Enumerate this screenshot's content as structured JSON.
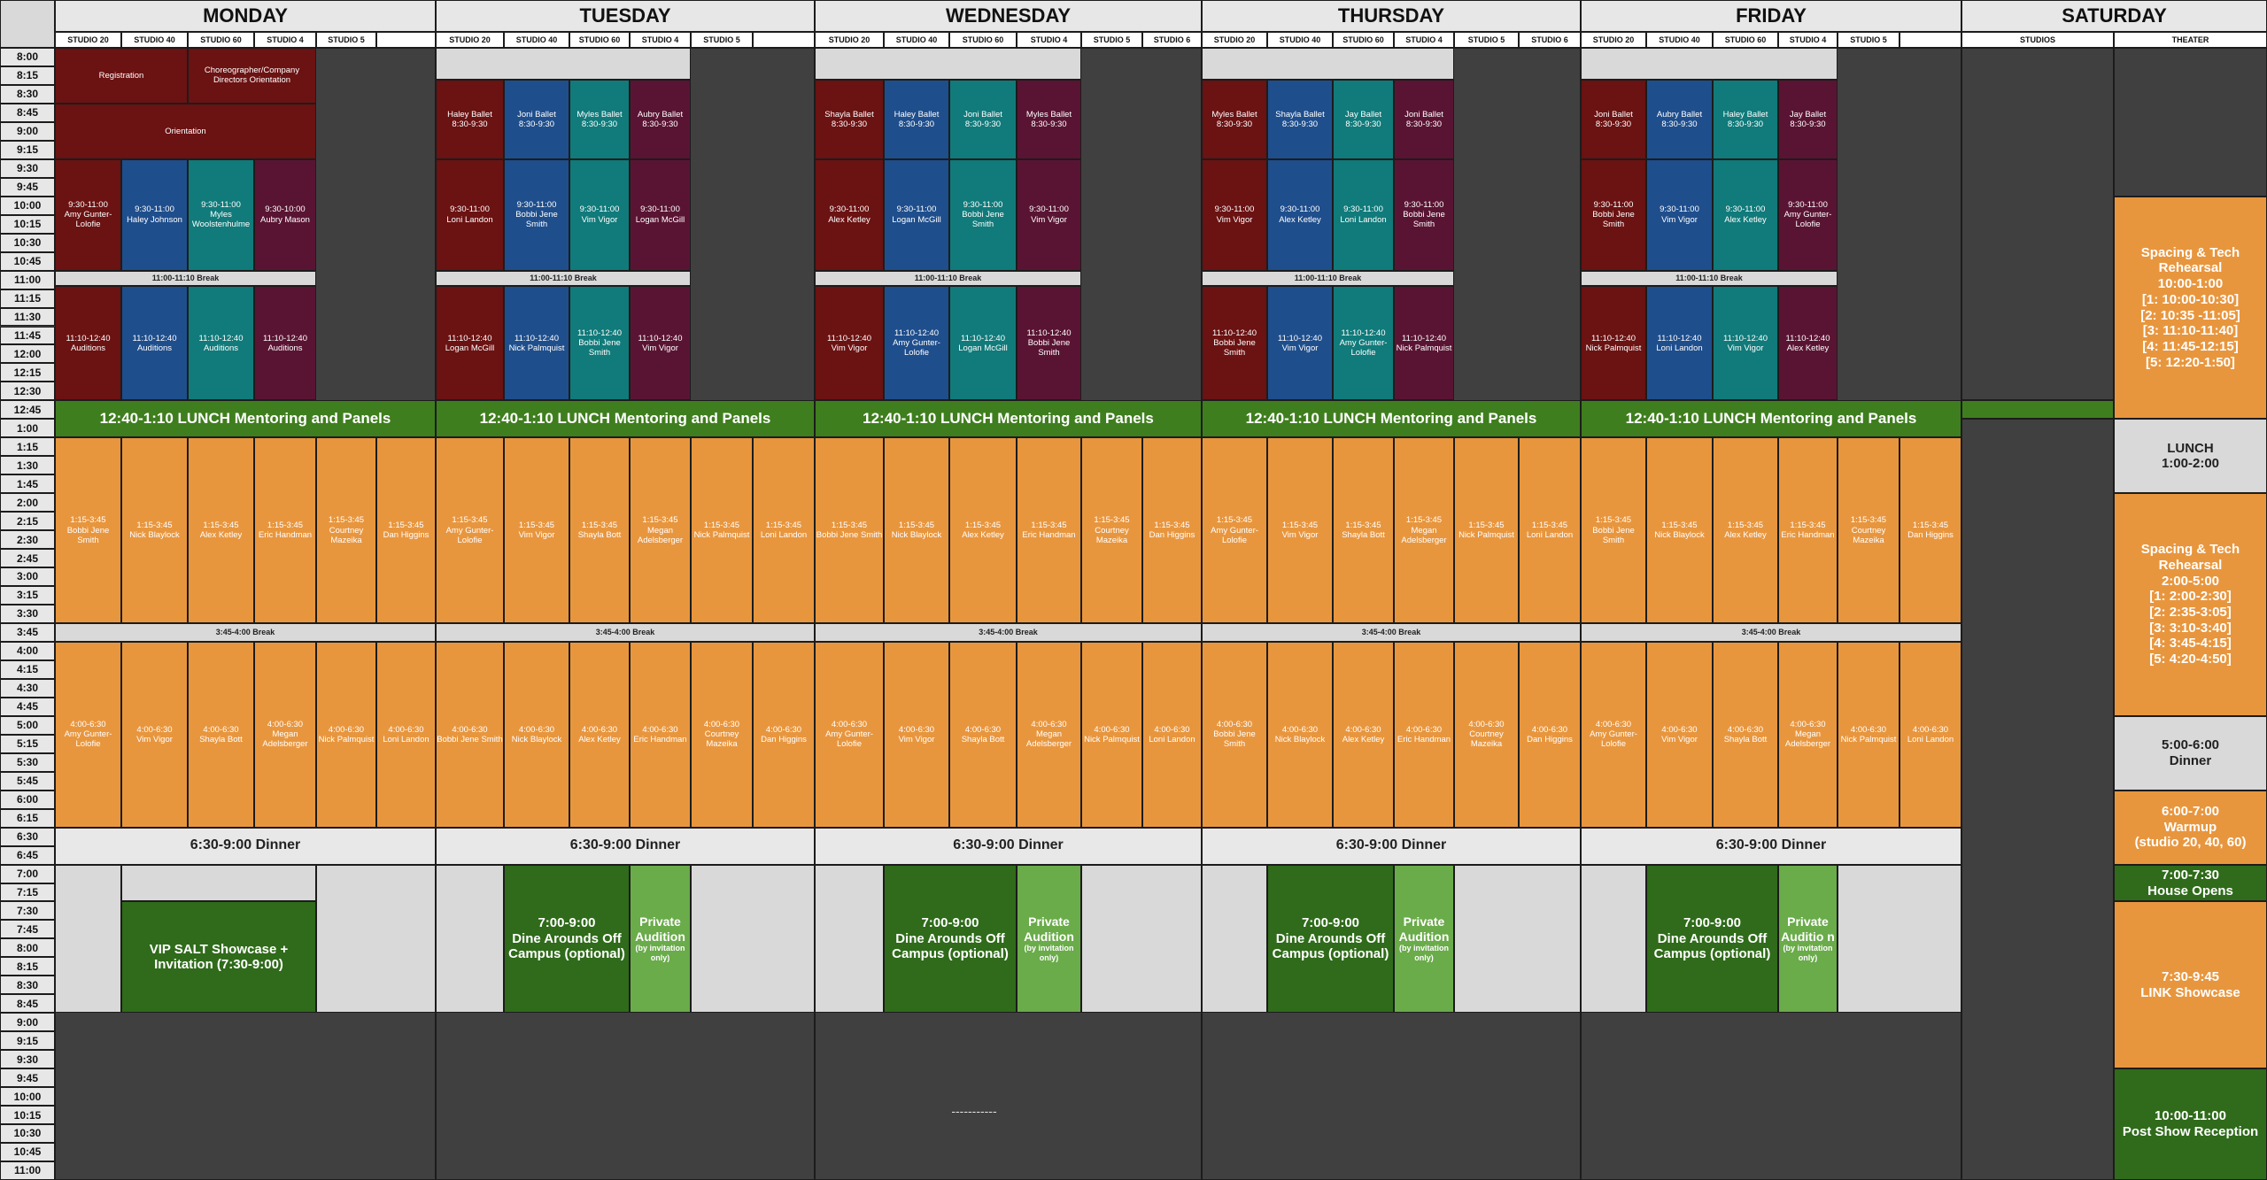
{
  "days": [
    "MONDAY",
    "TUESDAY",
    "WEDNESDAY",
    "THURSDAY",
    "FRIDAY",
    "SATURDAY"
  ],
  "studio_headers": {
    "mon": [
      "STUDIO 20",
      "STUDIO 40",
      "STUDIO 60",
      "STUDIO 4",
      "STUDIO 5"
    ],
    "tue": [
      "STUDIO 20",
      "STUDIO 40",
      "STUDIO 60",
      "STUDIO 4",
      "STUDIO 5"
    ],
    "wed": [
      "STUDIO 20",
      "STUDIO 40",
      "STUDIO 60",
      "STUDIO 4",
      "STUDIO 5",
      "STUDIO 6"
    ],
    "thu": [
      "STUDIO 20",
      "STUDIO 40",
      "STUDIO 60",
      "STUDIO 4",
      "STUDIO 5",
      "STUDIO 6"
    ],
    "fri": [
      "STUDIO 20",
      "STUDIO 40",
      "STUDIO 60",
      "STUDIO 4",
      "STUDIO 5"
    ],
    "sat": [
      "STUDIOS",
      "THEATER"
    ]
  },
  "times": [
    "8:00",
    "8:15",
    "8:30",
    "8:45",
    "9:00",
    "9:15",
    "9:30",
    "9:45",
    "10:00",
    "10:15",
    "10:30",
    "10:45",
    "11:00",
    "11:15",
    "11:30",
    "11:45",
    "12:00",
    "12:15",
    "12:30",
    "12:45",
    "1:00",
    "1:15",
    "1:30",
    "1:45",
    "2:00",
    "2:15",
    "2:30",
    "2:45",
    "3:00",
    "3:15",
    "3:30",
    "3:45",
    "4:00",
    "4:15",
    "4:30",
    "4:45",
    "5:00",
    "5:15",
    "5:30",
    "5:45",
    "6:00",
    "6:15",
    "6:30",
    "6:45",
    "7:00",
    "7:15",
    "7:30",
    "7:45",
    "8:00",
    "8:15",
    "8:30",
    "8:45",
    "9:00",
    "9:15",
    "9:30",
    "9:45",
    "10:00",
    "10:15",
    "10:30",
    "10:45",
    "11:00"
  ],
  "colors": {
    "maroon": "#6b1212",
    "blue": "#1f4e8c",
    "teal": "#117a7a",
    "plum": "#5a1433",
    "orange": "#e8963e",
    "green": "#3f7e1e",
    "dark_green": "#2f6b1a",
    "light_green": "#6aab4a",
    "gray": "#d9d9d9",
    "dark": "#404040"
  },
  "monday": {
    "registration": "Registration",
    "orientation_directors": "Choreographer/Company Directors Orientation",
    "orientation": "Orientation",
    "morning": [
      "9:30-11:00\nAmy Gunter-Lolofie",
      "9:30-11:00\nHaley Johnson",
      "9:30-11:00\nMyles Woolstenhulme",
      "9:30-10:00\nAubry Mason"
    ],
    "break_am": "11:00-11:10 Break",
    "auditions": [
      "11:10-12:40\nAuditions",
      "11:10-12:40\nAuditions",
      "11:10-12:40\nAuditions",
      "11:10-12:40\nAuditions"
    ],
    "lunch": "12:40-1:10 LUNCH Mentoring and Panels",
    "pm1": [
      "1:15-3:45\nBobbi Jene Smith",
      "1:15-3:45\nNick Blaylock",
      "1:15-3:45\nAlex Ketley",
      "1:15-3:45\nEric Handman",
      "1:15-3:45\nCourtney Mazeika",
      "1:15-3:45\nDan Higgins"
    ],
    "break_pm": "3:45-4:00 Break",
    "pm2": [
      "4:00-6:30\nAmy Gunter-Lolofie",
      "4:00-6:30\nVim Vigor",
      "4:00-6:30\nShayla Bott",
      "4:00-6:30\nMegan Adelsberger",
      "4:00-6:30\nNick Palmquist",
      "4:00-6:30\nLoni Landon"
    ],
    "dinner": "6:30-9:00 Dinner",
    "evening": "VIP SALT Showcase + Invitation (7:30-9:00)"
  },
  "tuesday": {
    "ballet": [
      "Haley Ballet\n8:30-9:30",
      "Joni Ballet\n8:30-9:30",
      "Myles Ballet\n8:30-9:30",
      "Aubry Ballet 8:30-9:30"
    ],
    "morning": [
      "9:30-11:00\nLoni Landon",
      "9:30-11:00\nBobbi Jene Smith",
      "9:30-11:00\nVim Vigor",
      "9:30-11:00\nLogan McGill"
    ],
    "break_am": "11:00-11:10 Break",
    "late": [
      "11:10-12:40\nLogan McGill",
      "11:10-12:40\nNick Palmquist",
      "11:10-12:40\nBobbi Jene Smith",
      "11:10-12:40\nVim Vigor"
    ],
    "lunch": "12:40-1:10 LUNCH Mentoring and Panels",
    "pm1": [
      "1:15-3:45\nAmy Gunter-Lolofie",
      "1:15-3:45\nVim Vigor",
      "1:15-3:45\nShayla Bott",
      "1:15-3:45\nMegan Adelsberger",
      "1:15-3:45\nNick Palmquist",
      "1:15-3:45\nLoni Landon"
    ],
    "break_pm": "3:45-4:00 Break",
    "pm2": [
      "4:00-6:30\nBobbi Jene Smith",
      "4:00-6:30\nNick Blaylock",
      "4:00-6:30\nAlex Ketley",
      "4:00-6:30\nEric Handman",
      "4:00-6:30\nCourtney Mazeika",
      "4:00-6:30\nDan Higgins"
    ],
    "dinner": "6:30-9:00 Dinner",
    "dine": "7:00-9:00\nDine Arounds Off Campus (optional)",
    "private": "Private Audition",
    "private_note": "(by invitation only)"
  },
  "wednesday": {
    "ballet": [
      "Shayla Ballet\n8:30-9:30",
      "Haley Ballet\n8:30-9:30",
      "Joni Ballet\n8:30-9:30",
      "Myles Ballet 8:30-9:30"
    ],
    "morning": [
      "9:30-11:00\nAlex Ketley",
      "9:30-11:00\nLogan McGill",
      "9:30-11:00\nBobbi Jene Smith",
      "9:30-11:00\nVim Vigor"
    ],
    "break_am": "11:00-11:10 Break",
    "late": [
      "11:10-12:40\nVim Vigor",
      "11:10-12:40\nAmy Gunter-Lolofie",
      "11:10-12:40\nLogan McGill",
      "11:10-12:40\nBobbi Jene Smith"
    ],
    "lunch": "12:40-1:10 LUNCH Mentoring and Panels",
    "pm1": [
      "1:15-3:45\nBobbi Jene Smith",
      "1:15-3:45\nNick Blaylock",
      "1:15-3:45\nAlex Ketley",
      "1:15-3:45\nEric Handman",
      "1:15-3:45\nCourtney Mazeika",
      "1:15-3:45\nDan Higgins"
    ],
    "break_pm": "3:45-4:00 Break",
    "pm2": [
      "4:00-6:30\nAmy Gunter-Lolofie",
      "4:00-6:30\nVim Vigor",
      "4:00-6:30\nShayla Bott",
      "4:00-6:30\nMegan Adelsberger",
      "4:00-6:30\nNick Palmquist",
      "4:00-6:30\nLoni Landon"
    ],
    "dinner": "6:30-9:00 Dinner",
    "dine": "7:00-9:00\nDine Arounds Off Campus (optional)",
    "private": "Private Audition",
    "private_note": "(by invitation only)"
  },
  "thursday": {
    "ballet": [
      "Myles Ballet\n8:30-9:30",
      "Shayla Ballet\n8:30-9:30",
      "Jay Ballet\n8:30-9:30",
      "Joni Ballet 8:30-9:30"
    ],
    "morning": [
      "9:30-11:00\nVim Vigor",
      "9:30-11:00\nAlex Ketley",
      "9:30-11:00\nLoni Landon",
      "9:30-11:00\nBobbi Jene Smith"
    ],
    "break_am": "11:00-11:10 Break",
    "late": [
      "11:10-12:40\nBobbi Jene Smith",
      "11:10-12:40\nVim Vigor",
      "11:10-12:40\nAmy Gunter-Lolofie",
      "11:10-12:40\nNick Palmquist"
    ],
    "lunch": "12:40-1:10 LUNCH Mentoring and Panels",
    "pm1": [
      "1:15-3:45\nAmy Gunter-Lolofie",
      "1:15-3:45\nVim Vigor",
      "1:15-3:45\nShayla Bott",
      "1:15-3:45\nMegan Adelsberger",
      "1:15-3:45\nNick Palmquist",
      "1:15-3:45\nLoni Landon"
    ],
    "break_pm": "3:45-4:00 Break",
    "pm2": [
      "4:00-6:30\nBobbi Jene Smith",
      "4:00-6:30\nNick Blaylock",
      "4:00-6:30\nAlex Ketley",
      "4:00-6:30\nEric Handman",
      "4:00-6:30\nCourtney Mazeika",
      "4:00-6:30\nDan Higgins"
    ],
    "dinner": "6:30-9:00 Dinner",
    "dine": "7:00-9:00\nDine Arounds Off Campus (optional)",
    "private": "Private Audition",
    "private_note": "(by invitation only)"
  },
  "friday": {
    "ballet": [
      "Joni Ballet\n8:30-9:30",
      "Aubry Ballet\n8:30-9:30",
      "Haley Ballet\n8:30-9:30",
      "Jay Ballet 8:30-9:30"
    ],
    "morning": [
      "9:30-11:00\nBobbi Jene Smith",
      "9:30-11:00\nVim Vigor",
      "9:30-11:00\nAlex Ketley",
      "9:30-11:00\nAmy Gunter-Lolofie"
    ],
    "break_am": "11:00-11:10 Break",
    "late": [
      "11:10-12:40\nNick Palmquist",
      "11:10-12:40\nLoni Landon",
      "11:10-12:40\nVim Vigor",
      "11:10-12:40\nAlex Ketley"
    ],
    "lunch": "12:40-1:10 LUNCH Mentoring and Panels",
    "pm1": [
      "1:15-3:45\nBobbi Jene Smith",
      "1:15-3:45\nNick Blaylock",
      "1:15-3:45\nAlex Ketley",
      "1:15-3:45\nEric Handman",
      "1:15-3:45\nCourtney Mazeika",
      "1:15-3:45\nDan Higgins"
    ],
    "break_pm": "3:45-4:00 Break",
    "pm2": [
      "4:00-6:30\nAmy Gunter-Lolofie",
      "4:00-6:30\nVim Vigor",
      "4:00-6:30\nShayla Bott",
      "4:00-6:30\nMegan Adelsberger",
      "4:00-6:30\nNick Palmquist",
      "4:00-6:30\nLoni Landon"
    ],
    "dinner": "6:30-9:00 Dinner",
    "dine": "7:00-9:00\nDine Arounds Off Campus (optional)",
    "private": "Private Auditio n",
    "private_note": "(by invitation only)"
  },
  "saturday": {
    "spacing_am": "Spacing & Tech Rehearsal\n10:00-1:00\n[1: 10:00-10:30]\n[2: 10:35 -11:05]\n[3: 11:10-11:40]\n[4: 11:45-12:15]\n[5: 12:20-1:50]",
    "lunch": "LUNCH\n1:00-2:00",
    "spacing_pm": "Spacing & Tech Rehearsal\n2:00-5:00\n[1: 2:00-2:30]\n[2: 2:35-3:05]\n[3: 3:10-3:40]\n[4: 3:45-4:15]\n[5: 4:20-4:50]",
    "dinner": "5:00-6:00\nDinner",
    "warmup": "6:00-7:00\nWarmup\n(studio 20, 40, 60)",
    "house": "7:00-7:30\nHouse Opens",
    "showcase": "7:30-9:45\nLINK Showcase",
    "reception": "10:00-11:00\nPost Show Reception"
  },
  "footer_note": "-----------"
}
